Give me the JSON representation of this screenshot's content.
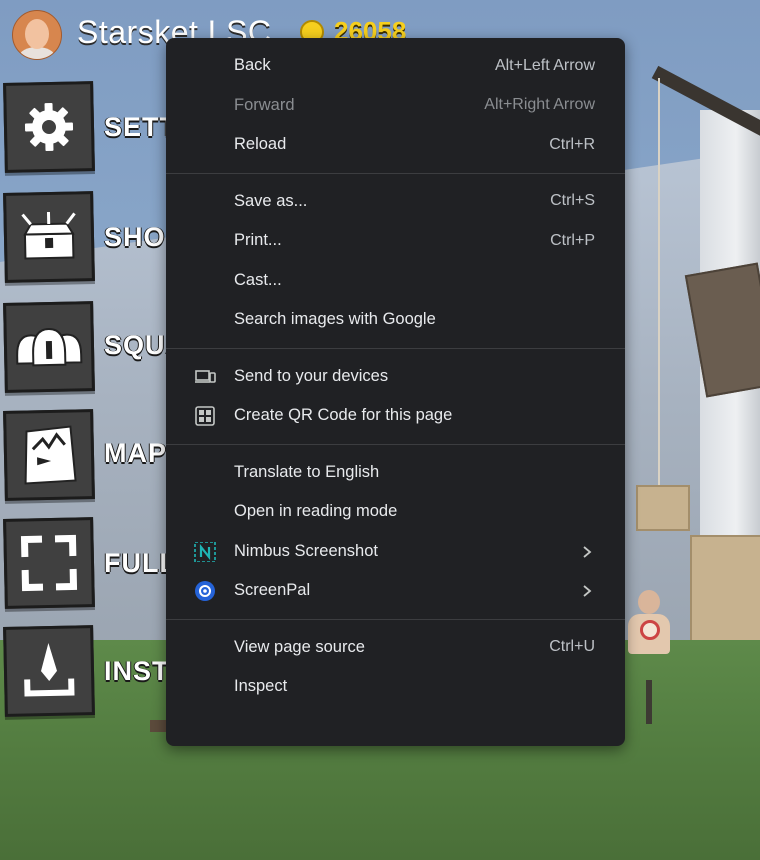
{
  "hud": {
    "player_name": "Starsket LSC",
    "coins": "26058",
    "coin_color": "#f6cf1e"
  },
  "game_menu": {
    "buttons": [
      {
        "label": "SETT",
        "icon": "gear-icon"
      },
      {
        "label": "SHOI",
        "icon": "treasure-chest-icon"
      },
      {
        "label": "SQUA",
        "icon": "squad-helmets-icon"
      },
      {
        "label": "MAP",
        "icon": "map-flag-icon"
      },
      {
        "label": "FULL",
        "icon": "fullscreen-icon"
      },
      {
        "label": "INST",
        "icon": "install-download-icon"
      }
    ]
  },
  "context_menu": {
    "sections": [
      [
        {
          "label": "Back",
          "shortcut": "Alt+Left Arrow",
          "enabled": true
        },
        {
          "label": "Forward",
          "shortcut": "Alt+Right Arrow",
          "enabled": false
        },
        {
          "label": "Reload",
          "shortcut": "Ctrl+R",
          "enabled": true
        }
      ],
      [
        {
          "label": "Save as...",
          "shortcut": "Ctrl+S",
          "enabled": true
        },
        {
          "label": "Print...",
          "shortcut": "Ctrl+P",
          "enabled": true
        },
        {
          "label": "Cast...",
          "shortcut": "",
          "enabled": true
        },
        {
          "label": "Search images with Google",
          "shortcut": "",
          "enabled": true
        }
      ],
      [
        {
          "label": "Send to your devices",
          "icon": "devices-icon",
          "enabled": true
        },
        {
          "label": "Create QR Code for this page",
          "icon": "qr-code-icon",
          "enabled": true
        }
      ],
      [
        {
          "label": "Translate to English",
          "enabled": true
        },
        {
          "label": "Open in reading mode",
          "enabled": true
        },
        {
          "label": "Nimbus Screenshot",
          "icon": "nimbus-extension-icon",
          "submenu": true,
          "enabled": true
        },
        {
          "label": "ScreenPal",
          "icon": "screenpal-extension-icon",
          "submenu": true,
          "enabled": true
        }
      ],
      [
        {
          "label": "View page source",
          "shortcut": "Ctrl+U",
          "enabled": true
        },
        {
          "label": "Inspect",
          "enabled": true
        }
      ]
    ],
    "colors": {
      "background": "#202124",
      "text": "#e8eaed",
      "disabled": "#8a8d91",
      "separator": "#3c3d40"
    }
  }
}
